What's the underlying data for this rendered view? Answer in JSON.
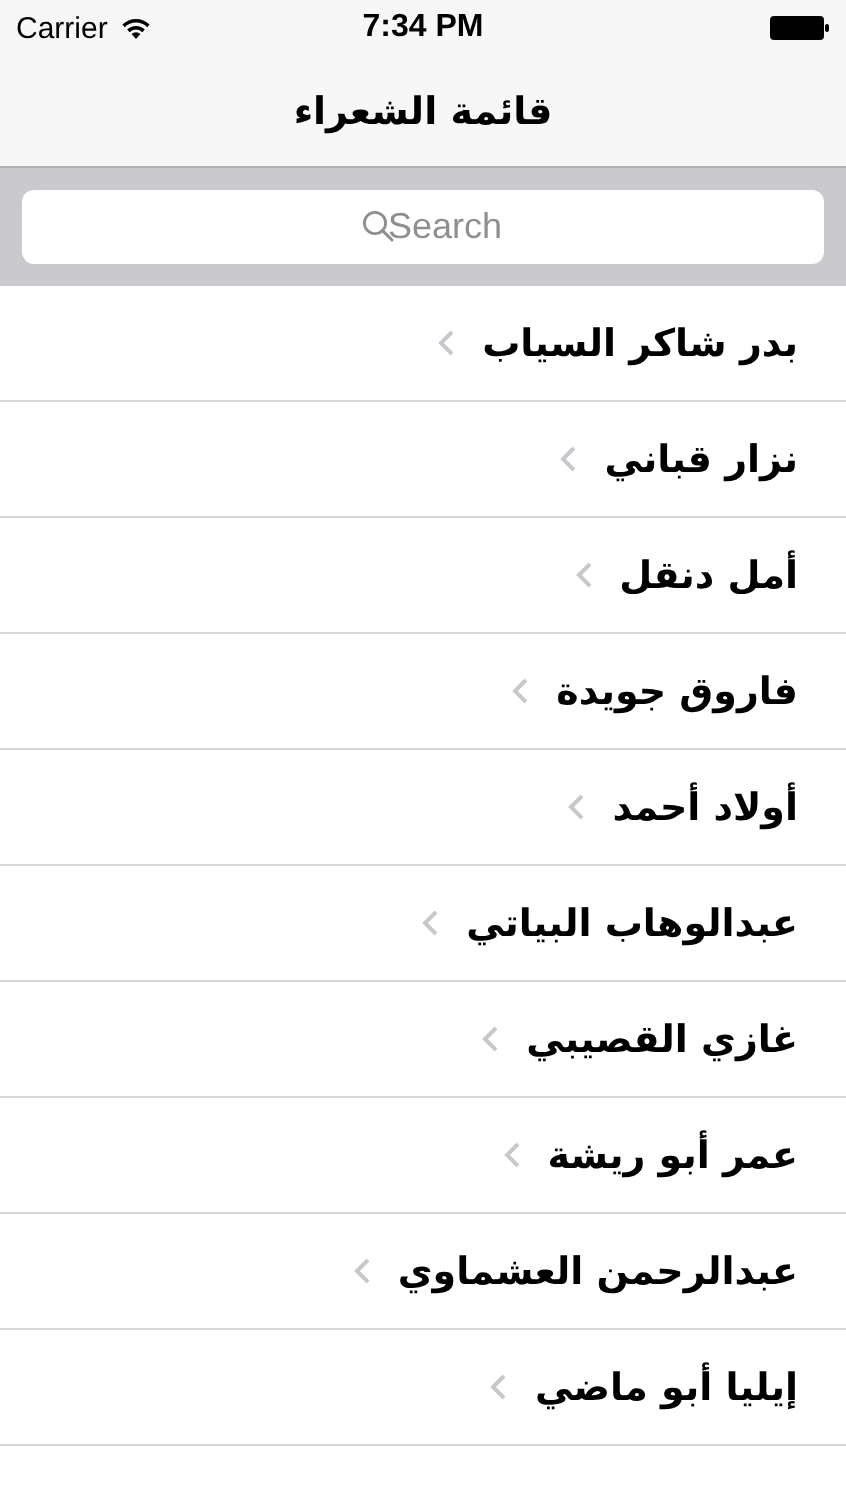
{
  "status_bar": {
    "carrier": "Carrier",
    "time": "7:34 PM"
  },
  "nav_bar": {
    "title": "قائمة الشعراء"
  },
  "search": {
    "placeholder": "Search"
  },
  "poets": [
    {
      "name": "بدر شاكر السياب"
    },
    {
      "name": "نزار قباني"
    },
    {
      "name": "أمل دنقل"
    },
    {
      "name": "فاروق جويدة"
    },
    {
      "name": "أولاد أحمد"
    },
    {
      "name": "عبدالوهاب البياتي"
    },
    {
      "name": "غازي القصيبي"
    },
    {
      "name": "عمر أبو ريشة"
    },
    {
      "name": "عبدالرحمن العشماوي"
    },
    {
      "name": "إيليا أبو ماضي"
    }
  ]
}
